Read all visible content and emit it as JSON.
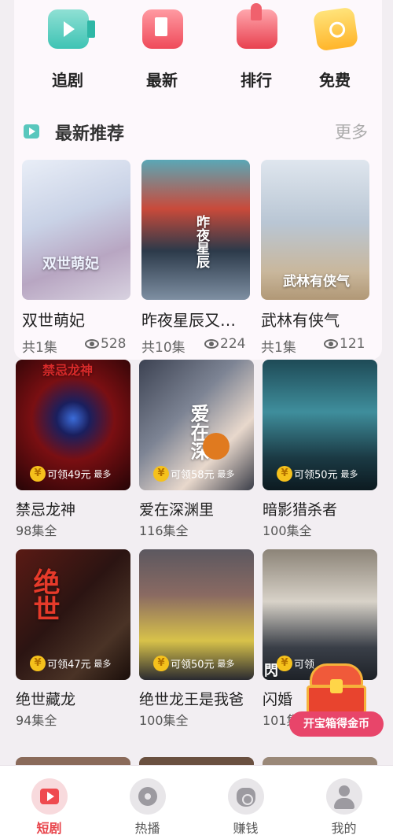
{
  "categories": [
    {
      "label": "追剧",
      "icon": "tv-play-icon"
    },
    {
      "label": "最新",
      "icon": "flag-icon"
    },
    {
      "label": "排行",
      "icon": "thumbs-up-icon"
    },
    {
      "label": "免费",
      "icon": "free-ticket-icon"
    }
  ],
  "section": {
    "title": "最新推荐",
    "more": "更多"
  },
  "recommended": [
    {
      "title": "双世萌妃",
      "poster_text": "双世萌妃",
      "episodes": "共1集",
      "views": "528"
    },
    {
      "title": "昨夜星辰又…",
      "poster_text": "昨夜星辰",
      "episodes": "共10集",
      "views": "224"
    },
    {
      "title": "武林有侠气",
      "poster_text": "武林有侠气",
      "episodes": "共1集",
      "views": "121"
    }
  ],
  "dramas": [
    {
      "title": "禁忌龙神",
      "episodes": "98集全",
      "reward": "可领49元",
      "reward_note": "最多",
      "poster_text": "禁忌龙神"
    },
    {
      "title": "爱在深渊里",
      "episodes": "116集全",
      "reward": "可领58元",
      "reward_note": "最多",
      "poster_text": "爱在深"
    },
    {
      "title": "暗影猎杀者",
      "episodes": "100集全",
      "reward": "可领50元",
      "reward_note": "最多",
      "poster_text": ""
    },
    {
      "title": "绝世藏龙",
      "episodes": "94集全",
      "reward": "可领47元",
      "reward_note": "最多",
      "poster_text": "绝世"
    },
    {
      "title": "绝世龙王是我爸",
      "episodes": "100集全",
      "reward": "可领50元",
      "reward_note": "最多",
      "poster_text": ""
    },
    {
      "title": "闪婚",
      "episodes": "101集全",
      "reward": "可领",
      "reward_note": "",
      "poster_text": "閃"
    }
  ],
  "coin_symbol": "¥",
  "treasure": {
    "label": "开宝箱得金币"
  },
  "bottom_nav": [
    {
      "label": "短剧",
      "active": true
    },
    {
      "label": "热播",
      "active": false
    },
    {
      "label": "赚钱",
      "active": false
    },
    {
      "label": "我的",
      "active": false
    }
  ],
  "colors": {
    "accent": "#e8434a",
    "badge_coin": "#f5c11c",
    "treasure_button": "#e8456a"
  }
}
